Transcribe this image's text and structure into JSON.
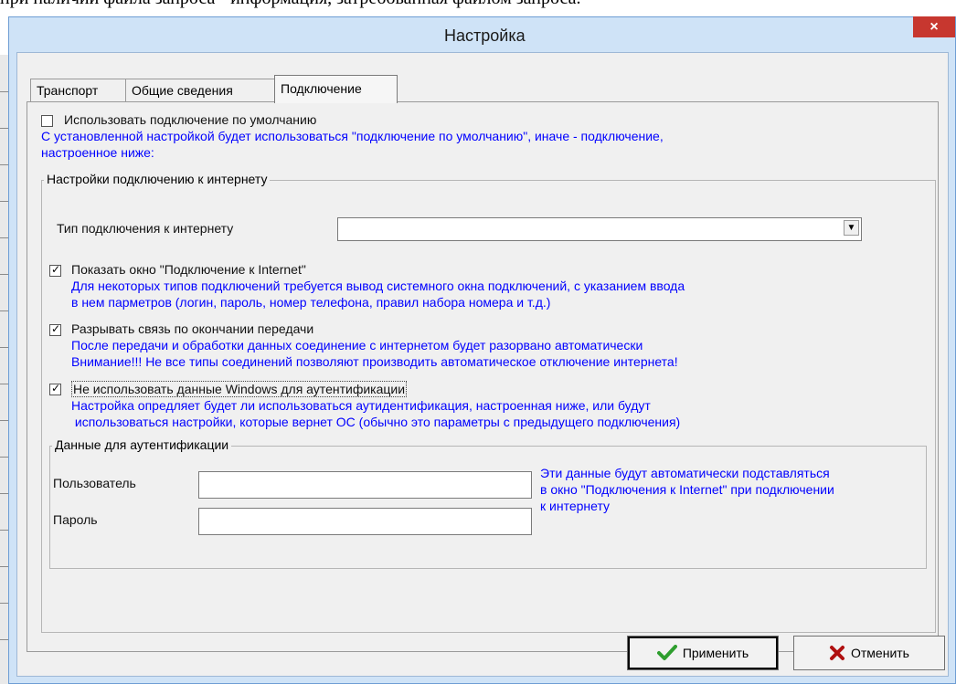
{
  "background_text": "при наличии файла запроса - информация, затребованная файлом запроса.",
  "window": {
    "title": "Настройка",
    "close": "×"
  },
  "tabs": [
    {
      "label": "Транспорт"
    },
    {
      "label": "Общие сведения"
    },
    {
      "label": "Подключение",
      "active": true
    }
  ],
  "default_connection": {
    "label": "Использовать подключение по умолчанию",
    "checked": false,
    "hint_line1": "С установленной настройкой будет использоваться \"подключение по умолчанию\", иначе - подключение,",
    "hint_line2": "настроенное ниже:"
  },
  "internet_group": {
    "title": "Настройки подключению к интернету",
    "connection_type_label": "Тип подключения к интернету",
    "connection_type_value": "",
    "show_window": {
      "label": "Показать окно \"Подключение к Internet\"",
      "checked": true,
      "hint_line1": "Для некоторых типов подключений требуется вывод системного окна подключений, с указанием ввода",
      "hint_line2": "в нем парметров (логин, пароль, номер телефона, правил набора номера и т.д.)"
    },
    "disconnect": {
      "label": "Разрывать связь по окончании передачи",
      "checked": true,
      "hint_line1": "После передачи и обработки данных соединение с интернетом будет разорвано автоматически",
      "hint_line2": "Внимание!!! Не все типы соединений позволяют производить автоматическое отключение интернета!"
    },
    "no_windows_auth": {
      "label": "Не использовать данные Windows для аутентификации",
      "checked": true,
      "hint_line1": "Настройка опредляет будет ли использоваться аутидентификация, настроенная ниже, или будут",
      "hint_line2": " использоваться настройки, которые вернет ОС (обычно это параметры с предыдущего подключения)"
    },
    "auth": {
      "title": "Данные для аутентификации",
      "user_label": "Пользователь",
      "user_value": "",
      "password_label": "Пароль",
      "password_value": "",
      "note_line1": "Эти данные будут автоматически подставляться",
      "note_line2": "в окно \"Подключения к Internet\" при подключении",
      "note_line3": "к интернету"
    }
  },
  "buttons": {
    "apply": "Применить",
    "cancel": "Отменить"
  },
  "colors": {
    "hint_text": "#0000ff",
    "apply_icon": "#2e9e2e",
    "cancel_icon": "#b01010",
    "close_button": "#c7372f"
  }
}
